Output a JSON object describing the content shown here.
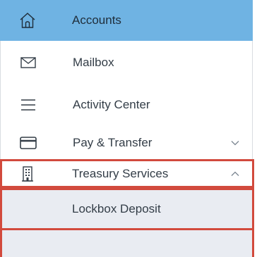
{
  "nav": {
    "items": [
      {
        "label": "Accounts",
        "icon": "home-icon"
      },
      {
        "label": "Mailbox",
        "icon": "envelope-icon"
      },
      {
        "label": "Activity Center",
        "icon": "menu-lines-icon"
      },
      {
        "label": "Pay & Transfer",
        "icon": "card-icon",
        "chevron": "chevron-down-icon"
      },
      {
        "label": "Treasury Services",
        "icon": "building-icon",
        "chevron": "chevron-up-icon"
      },
      {
        "label": "Lockbox Deposit"
      }
    ]
  },
  "colors": {
    "accent": "#6fb3e3",
    "highlight_border": "#d24a3d",
    "submenu_bg": "#e9ecf2",
    "text": "#333d47"
  }
}
